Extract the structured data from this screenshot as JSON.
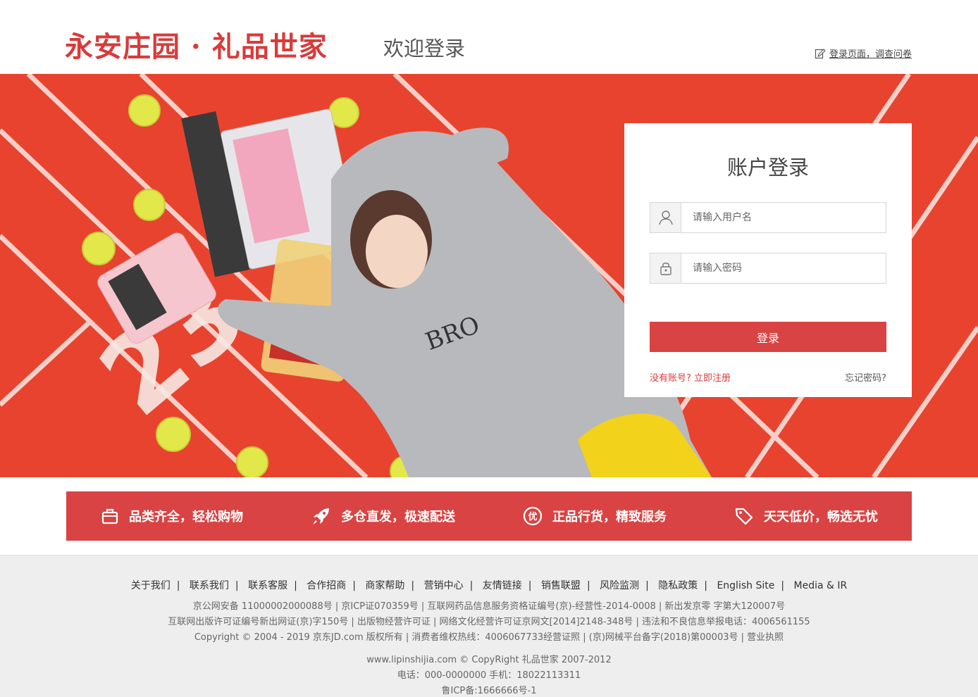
{
  "header": {
    "logo": "永安庄园 · 礼品世家",
    "welcome": "欢迎登录",
    "survey_link": "登录页面，调查问卷"
  },
  "login": {
    "title": "账户登录",
    "username_placeholder": "请输入用户名",
    "password_placeholder": "请输入密码",
    "submit_label": "登录",
    "register_link": "没有账号? 立即注册",
    "forgot_link": "忘记密码?"
  },
  "features": [
    {
      "icon": "bag-icon",
      "label": "品类齐全，轻松购物"
    },
    {
      "icon": "rocket-icon",
      "label": "多仓直发，极速配送"
    },
    {
      "icon": "quality-icon",
      "label": "正品行货，精致服务"
    },
    {
      "icon": "price-tag-icon",
      "label": "天天低价，畅选无忧"
    }
  ],
  "footer": {
    "links": [
      "关于我们",
      "联系我们",
      "联系客服",
      "合作招商",
      "商家帮助",
      "营销中心",
      "友情链接",
      "销售联盟",
      "风险监测",
      "隐私政策",
      "English Site",
      "Media & IR"
    ],
    "line1": "京公网安备 11000002000088号  |  京ICP证070359号  |  互联网药品信息服务资格证编号(京)-经营性-2014-0008  |  新出发京零 字第大120007号",
    "line2": "互联网出版许可证编号新出网证(京)字150号  |  出版物经营许可证  |  网络文化经营许可证京网文[2014]2148-348号  |  违法和不良信息举报电话：4006561155",
    "line3": "Copyright © 2004 - 2019 京东JD.com 版权所有  |  消费者维权热线：4006067733经营证照  |  (京)网械平台备字(2018)第00003号  |  营业执照",
    "site": "www.lipinshijia.com © CopyRight 礼品世家 2007-2012",
    "contact": "电话：000-0000000 手机：18022113311",
    "icp": "鲁ICP备:1666666号-1"
  },
  "colors": {
    "brand_red": "#d83b3b",
    "button_red": "#d94343",
    "banner_red": "#e8432f"
  }
}
